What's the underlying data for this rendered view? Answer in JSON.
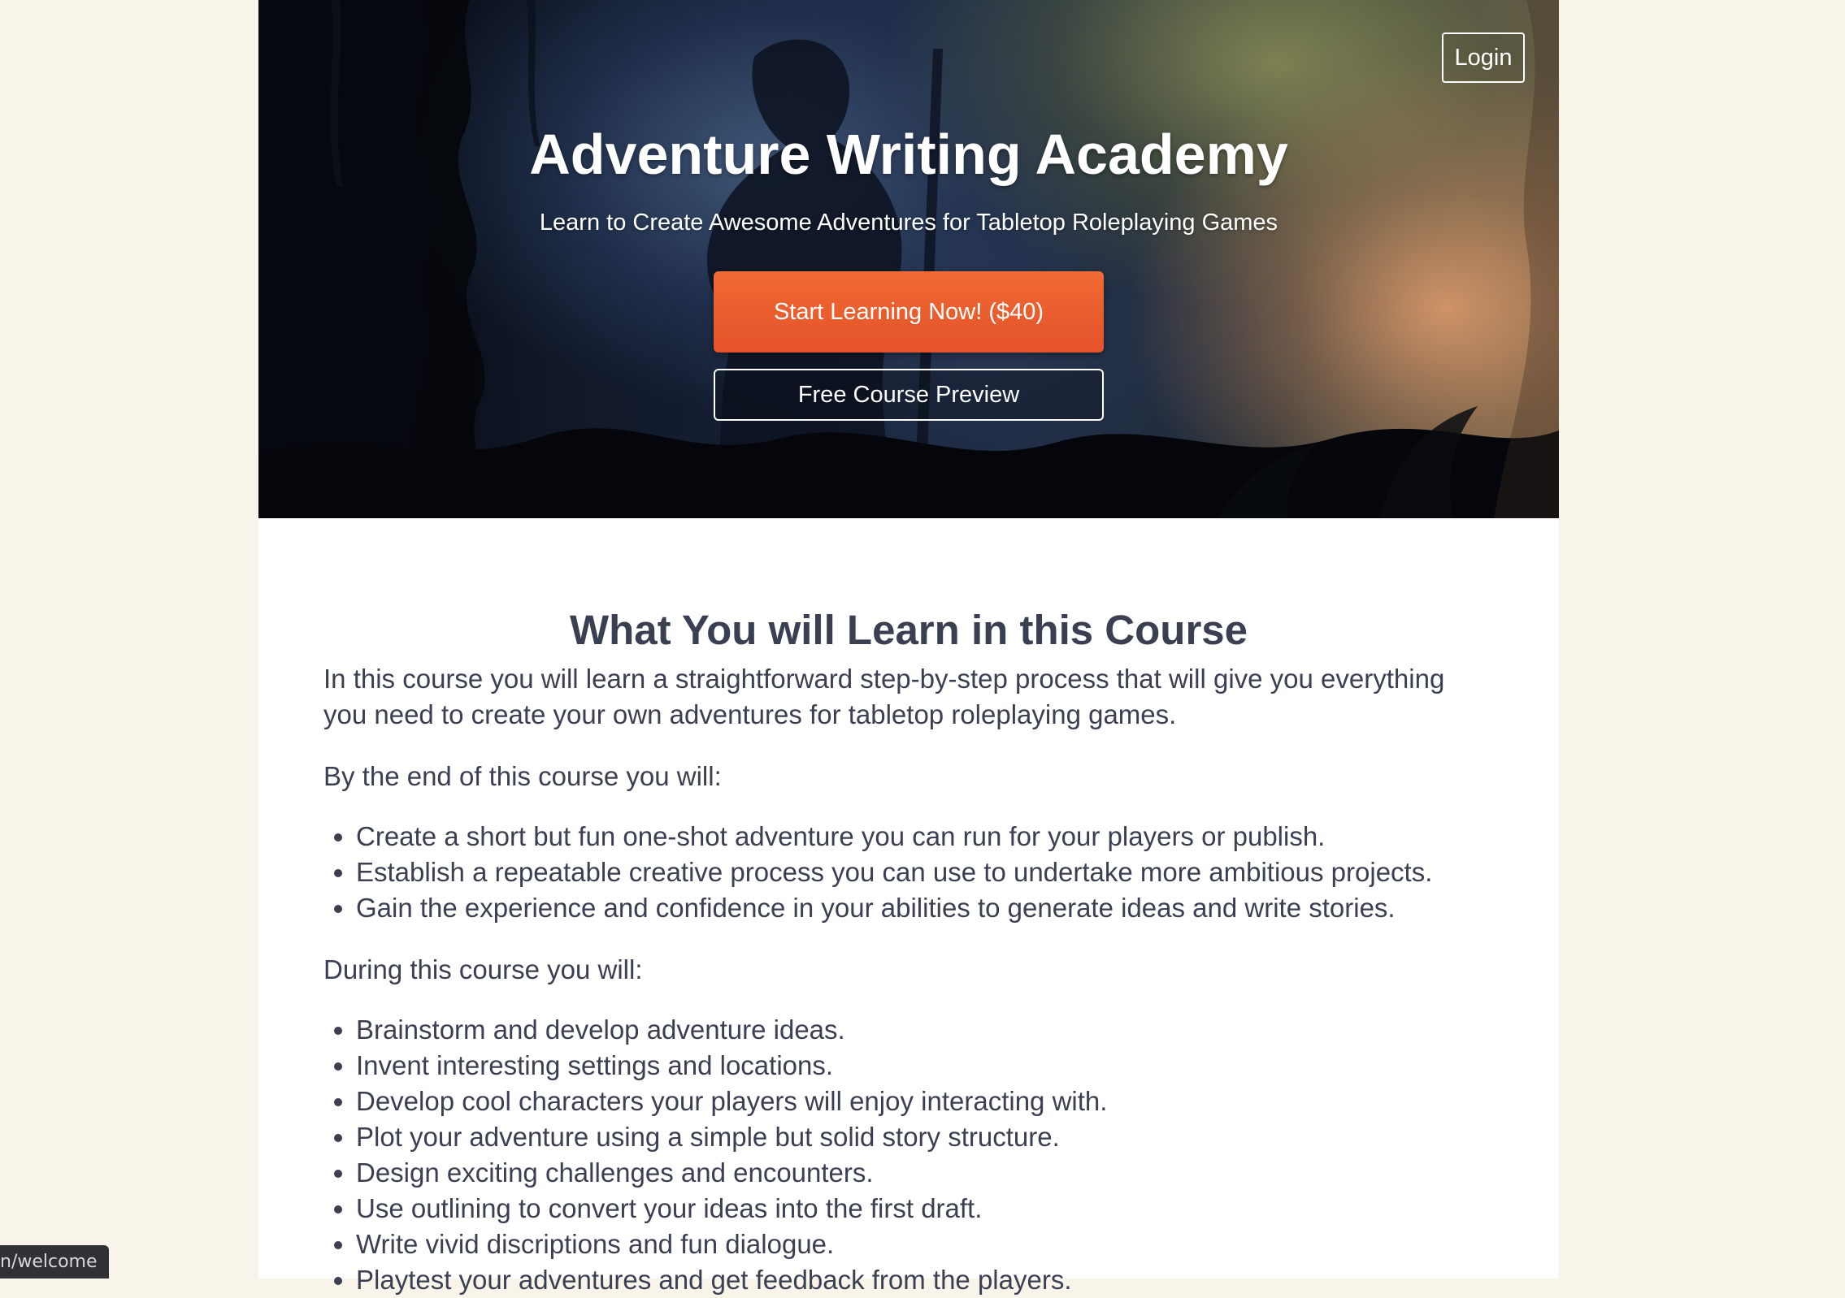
{
  "header": {
    "login_label": "Login",
    "title": "Adventure Writing Academy",
    "subtitle": "Learn to Create Awesome Adventures for Tabletop Roleplaying Games",
    "cta_primary_label": "Start Learning Now! ($40)",
    "cta_secondary_label": "Free Course Preview"
  },
  "main": {
    "section_title": "What You will Learn in this Course",
    "intro": "In this course you will learn a straightforward step-by-step process that will give you everything you need to create your own adventures for tabletop roleplaying games.",
    "outcomes_lead": "By the end of this course you will:",
    "outcomes": [
      "Create a short but fun one-shot adventure you can run for your players or publish.",
      "Establish a repeatable creative process you can use to undertake more ambitious projects.",
      "Gain the experience and confidence in your abilities to generate ideas and write stories."
    ],
    "activities_lead": "During this course you will:",
    "activities": [
      "Brainstorm and develop adventure ideas.",
      "Invent interesting settings and locations.",
      "Develop cool characters your players will enjoy interacting with.",
      "Plot your adventure using a simple but solid story structure.",
      "Design exciting challenges and encounters.",
      "Use outlining to convert your ideas into the first draft.",
      "Write vivid discriptions and fun dialogue.",
      "Playtest your adventures and get feedback from the players."
    ]
  },
  "status_bar": {
    "url_text": "n/welcome"
  },
  "colors": {
    "page_background": "#f8f4ea",
    "cta_primary": "#e85a2c",
    "text": "#3a3f52"
  }
}
